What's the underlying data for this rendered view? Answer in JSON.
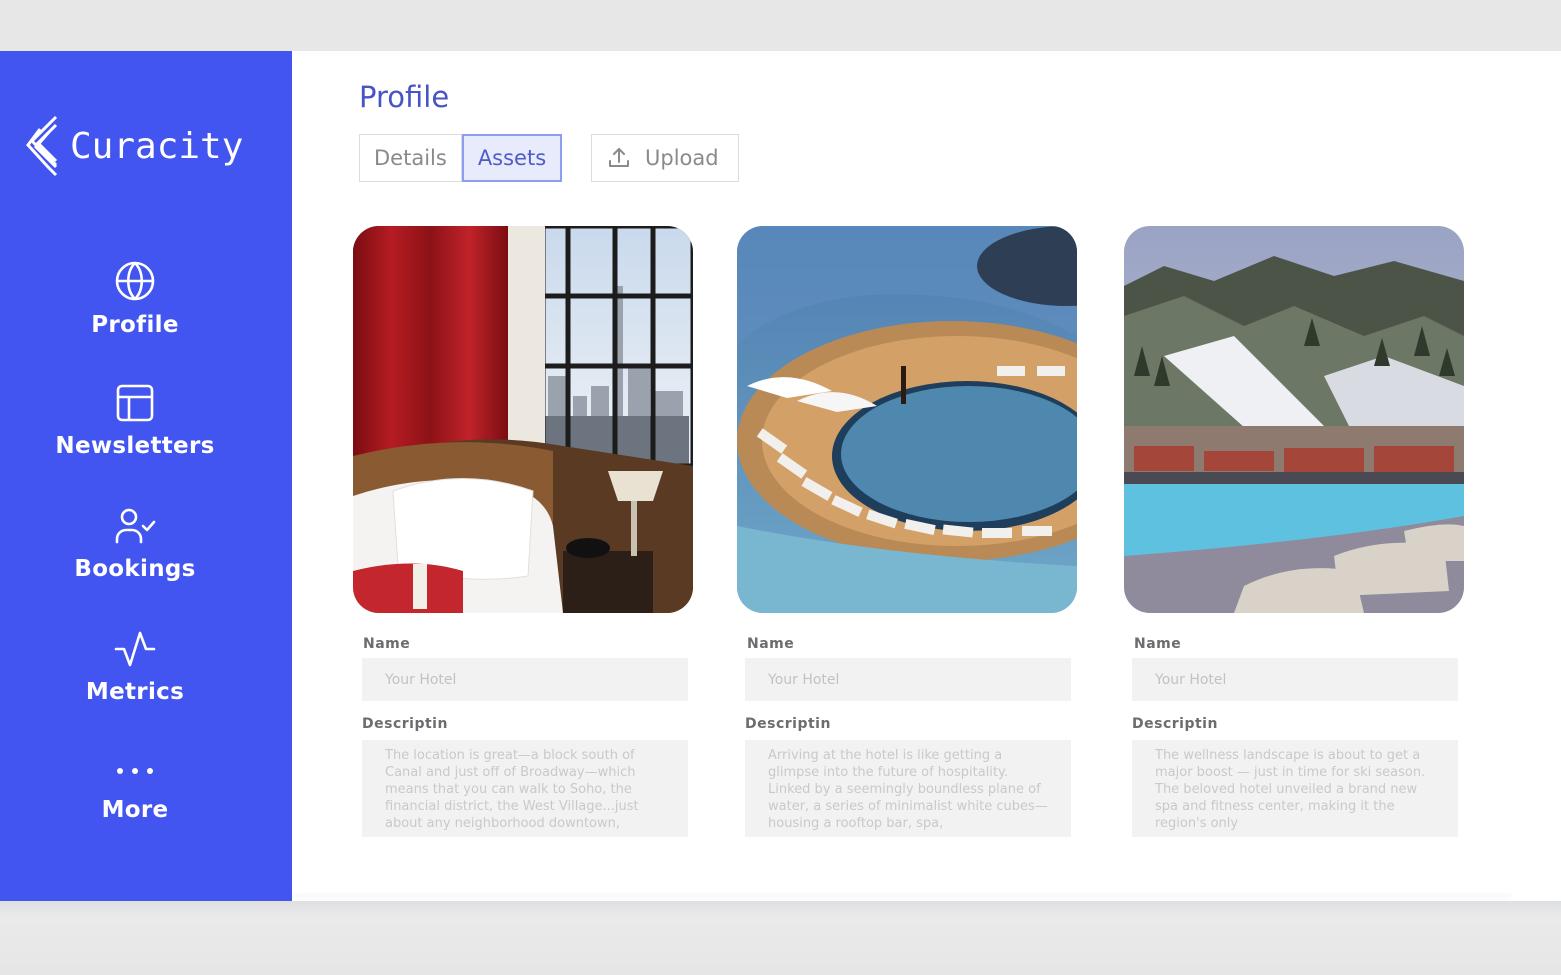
{
  "app": {
    "brand_name": "Curacity",
    "brand_color": "#4355f0"
  },
  "sidebar": {
    "items": [
      {
        "label": "Profile",
        "icon": "globe-icon"
      },
      {
        "label": "Newsletters",
        "icon": "layout-icon"
      },
      {
        "label": "Bookings",
        "icon": "user-check-icon"
      },
      {
        "label": "Metrics",
        "icon": "activity-icon"
      },
      {
        "label": "More",
        "icon": "more-dots-icon"
      }
    ]
  },
  "main": {
    "title": "Profile",
    "tabs": [
      {
        "label": "Details",
        "active": false
      },
      {
        "label": "Assets",
        "active": true
      }
    ],
    "upload_label": "Upload",
    "cards": [
      {
        "image": "hotel-room-icon",
        "name_label": "Name",
        "name_placeholder": "Your Hotel",
        "desc_label": "Descriptin",
        "desc_placeholder": "The location is great—a block south of Canal and just off of Broadway—which means that you can walk to Soho, the financial district, the West Village...just about any neighborhood downtown,"
      },
      {
        "image": "rooftop-pool-icon",
        "name_label": "Name",
        "name_placeholder": "Your Hotel",
        "desc_label": "Descriptin",
        "desc_placeholder": "Arriving at the hotel is like getting a glimpse into the future of hospitality. Linked by a seemingly boundless plane of water, a series of minimalist white cubes—housing a rooftop bar, spa,"
      },
      {
        "image": "mountain-pool-icon",
        "name_label": "Name",
        "name_placeholder": "Your Hotel",
        "desc_label": "Descriptin",
        "desc_placeholder": "The wellness landscape is about to get a major boost — just in time for ski season. The beloved hotel unveiled a brand new spa and fitness center, making it the region's only"
      }
    ]
  }
}
